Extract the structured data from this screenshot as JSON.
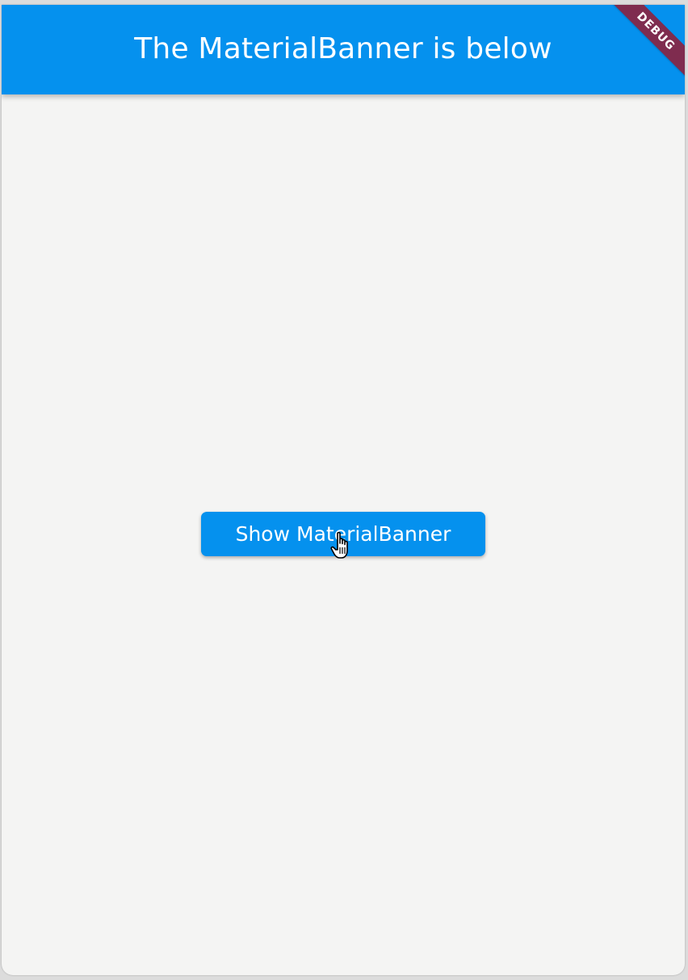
{
  "app_bar": {
    "title": "The MaterialBanner is below",
    "color": "#0591EE"
  },
  "debug_banner": {
    "label": "DEBUG",
    "color": "#7F2C4F"
  },
  "main": {
    "show_button_label": "Show MaterialBanner",
    "button_color": "#0591EE",
    "background": "#F4F4F3"
  },
  "cursor": {
    "icon": "hand-pointer-icon"
  }
}
